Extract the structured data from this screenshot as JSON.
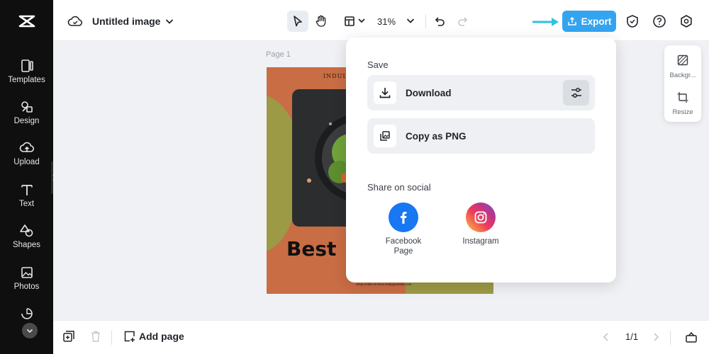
{
  "sidebar": {
    "items": [
      {
        "label": "Templates",
        "icon": "templates-icon"
      },
      {
        "label": "Design",
        "icon": "design-icon"
      },
      {
        "label": "Upload",
        "icon": "upload-icon"
      },
      {
        "label": "Text",
        "icon": "text-icon"
      },
      {
        "label": "Shapes",
        "icon": "shapes-icon"
      },
      {
        "label": "Photos",
        "icon": "photos-icon"
      }
    ]
  },
  "topbar": {
    "title": "Untitled image",
    "zoom": "31%",
    "export_label": "Export"
  },
  "canvas": {
    "page_label": "Page 1",
    "artboard_heading_small": "INDULGE IN",
    "artboard_big_text": "Best",
    "artboard_footer": "Shop online at www.reallygreatsite.com"
  },
  "bottombar": {
    "add_page_label": "Add page",
    "page_count": "1/1"
  },
  "right_panel": {
    "background_label": "Backgr...",
    "resize_label": "Resize"
  },
  "export_panel": {
    "save_title": "Save",
    "download_label": "Download",
    "copy_png_label": "Copy as PNG",
    "share_title": "Share on social",
    "facebook_label": "Facebook Page",
    "instagram_label": "Instagram"
  },
  "colors": {
    "export_button": "#35a4f0",
    "arrow": "#2ec3dd",
    "sidebar_bg": "#0f0f0f",
    "artboard_bg": "#c96d45",
    "artboard_accent": "#9c9a45",
    "facebook": "#1877f2"
  }
}
